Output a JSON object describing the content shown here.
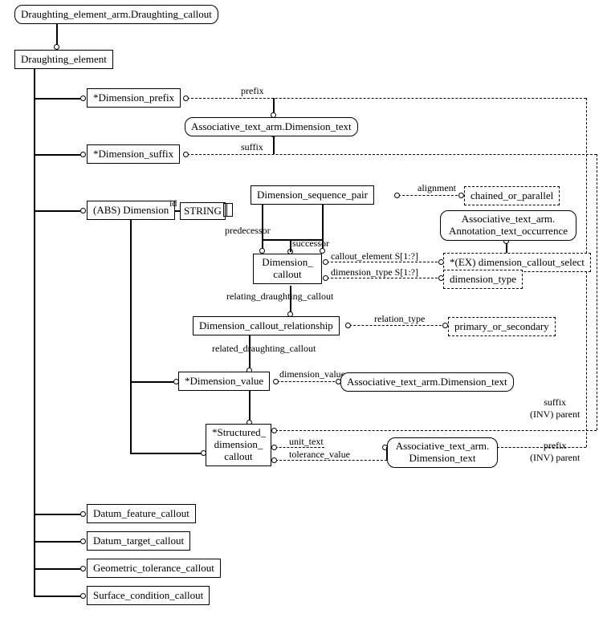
{
  "root": {
    "title": "Draughting_element_arm.Draughting_callout"
  },
  "base": {
    "title": "Draughting_element"
  },
  "nodes": {
    "dim_prefix": "*Dimension_prefix",
    "dim_suffix": "*Dimension_suffix",
    "abs_dimension": "(ABS) Dimension",
    "string": "STRING",
    "dim_seq_pair": "Dimension_sequence_pair",
    "chained_or_parallel": "chained_or_parallel",
    "ann_text_occ_l1": "Associative_text_arm.",
    "ann_text_occ_l2": "Annotation_text_occurrence",
    "dim_callout": "Dimension_\ncallout",
    "dim_callout_select": "*(EX) dimension_callout_select",
    "dim_type": "dimension_type",
    "dim_callout_rel": "Dimension_callout_relationship",
    "primary_or_secondary": "primary_or_secondary",
    "dim_value": "*Dimension_value",
    "assoc_dim_text": "Associative_text_arm.Dimension_text",
    "struct_dim_callout": "*Structured_\ndimension_\ncallout",
    "assoc_dim_text_ml_l1": "Associative_text_arm.",
    "assoc_dim_text_ml_l2": "Dimension_text",
    "datum_feature": "Datum_feature_callout",
    "datum_target": "Datum_target_callout",
    "geo_tol": "Geometric_tolerance_callout",
    "surf_cond": "Surface_condition_callout"
  },
  "edge_labels": {
    "prefix": "prefix",
    "suffix": "suffix",
    "id": "id",
    "alignment": "alignment",
    "predecessor": "predecessor",
    "successor": "successor",
    "callout_element": "callout_element S[1:?]",
    "dimension_type": "dimension_type S[1:?]",
    "relating": "relating_draughting_callout",
    "relation_type": "relation_type",
    "related": "related_draughting_callout",
    "dimension_value": "dimension_value",
    "unit_text": "unit_text",
    "tolerance_value": "tolerance_value",
    "suffix_inv": "suffix\n(INV) parent",
    "prefix_inv": "prefix\n(INV) parent"
  }
}
